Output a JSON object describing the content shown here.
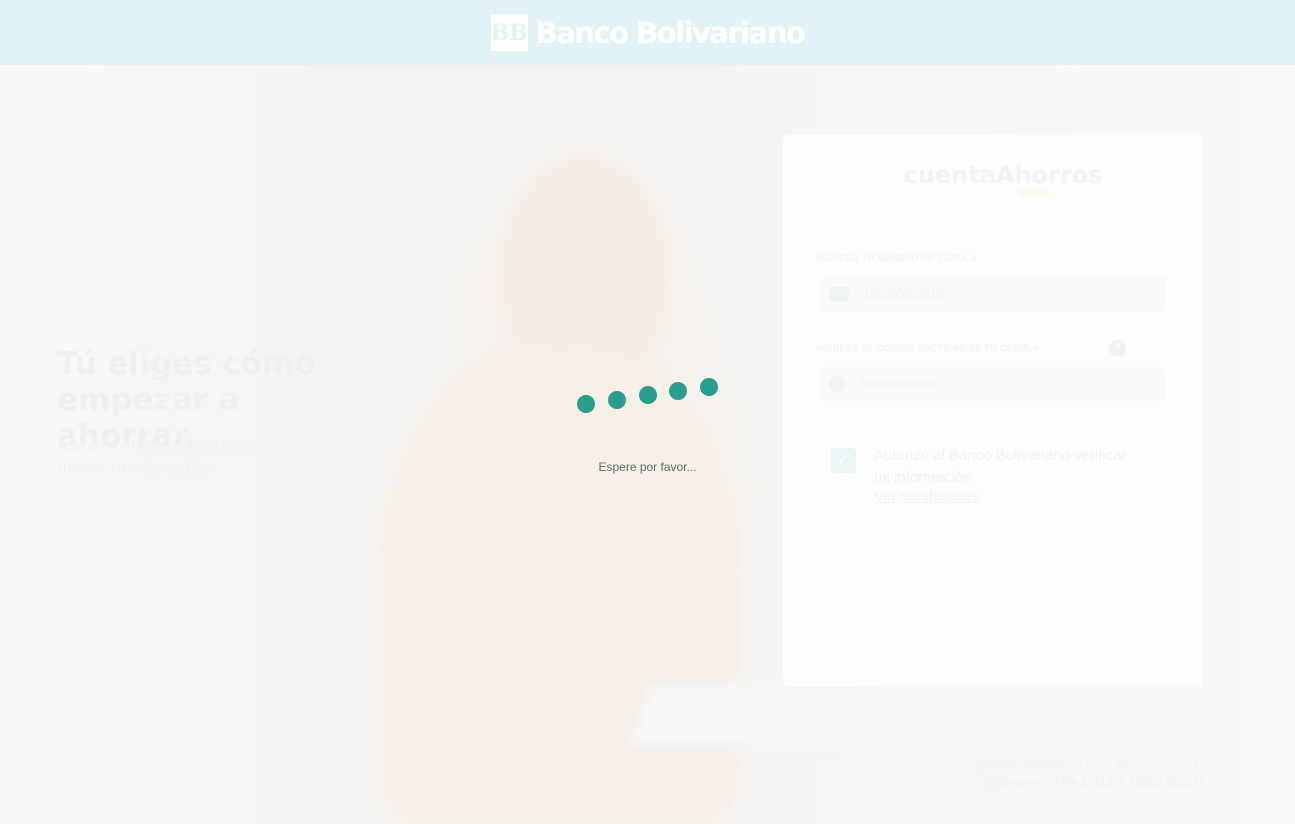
{
  "header": {
    "brand_name": "Banco Bolivariano",
    "brand_mark": "BB"
  },
  "hero": {
    "title": "Tú eliges cómo empezar a ahorrar.",
    "subtitle": "Abre tu cuenta de ahorros online desde donde estás."
  },
  "form": {
    "product_name": "cuentaAhorros",
    "product_tag": "online",
    "id_label": "INGRESA TU NÚMERO DE CÉDULA",
    "id_placeholder": "0909090909",
    "fingerprint_label": "INGRESA EL CÓDIGO DACTILAR DE TU CÉDULA",
    "fingerprint_placeholder": "V000000000",
    "help_icon": "?",
    "consent_text": "Autorizo al Banco Bolivariano verificar mi información",
    "conditions_link": "Ver condiciones",
    "checkbox_checked": true
  },
  "footer": {
    "question": "¿Tienes problemas para abrir tu cuenta?",
    "call": "Llámanos al 04-3731000 / 0800 262266"
  },
  "loader": {
    "message": "Espere por favor...",
    "dot_color": "#2a9d8f"
  },
  "colors": {
    "header_bg": "#e2f3f7",
    "accent": "#2a9d8f"
  }
}
